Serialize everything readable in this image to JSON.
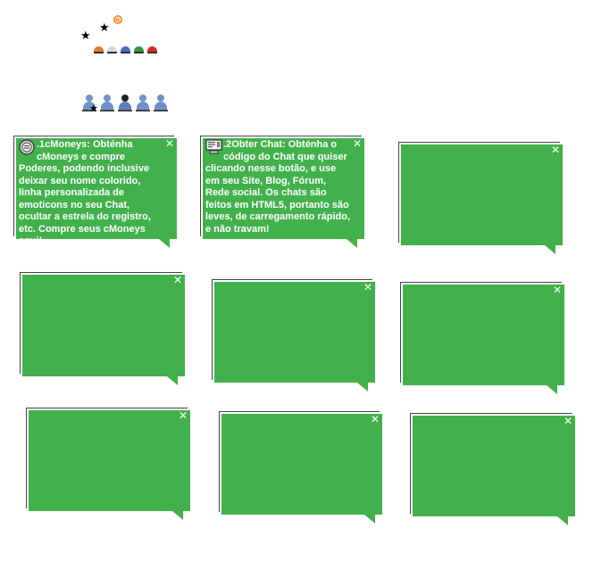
{
  "header": {
    "stars": [
      "star-icon",
      "star-icon"
    ],
    "badge_icon": "clock-icon",
    "caps": [
      {
        "name": "orange-cap-icon",
        "color": "#e07a2c"
      },
      {
        "name": "white-cap-icon",
        "color": "#d8d8d8"
      },
      {
        "name": "blue-cap-icon",
        "color": "#4a6fc4"
      },
      {
        "name": "green-cap-icon",
        "color": "#2e9a3a"
      },
      {
        "name": "red-cap-icon",
        "color": "#d42a2a"
      }
    ],
    "users": [
      "user-icon",
      "user-icon",
      "user-icon",
      "user-icon",
      "user-icon"
    ]
  },
  "bubbles": [
    {
      "number": ".1",
      "title": "cMoneys:",
      "text": "Obténha cMoneys e compre Poderes, podendo inclusive deixar seu nome colorido, linha personalizada de emoticons no seu Chat, ocultar a estrela do registro, etc. Compre seus cMoneys",
      "link": "aqui!",
      "icon": "coin-icon"
    },
    {
      "number": ".2",
      "title": "Obter Chat:",
      "text": "Obténha o código do Chat que quiser clicando nesse botão, e use em seu Site, Blog, Fórum, Rede social. Os chats são feitos em HTML5, portanto são leves, de carregamento rápido, e não travam!",
      "icon": "computer-icon"
    }
  ],
  "colors": {
    "bubble_green": "#42b14c",
    "text_white": "#ffffff"
  }
}
